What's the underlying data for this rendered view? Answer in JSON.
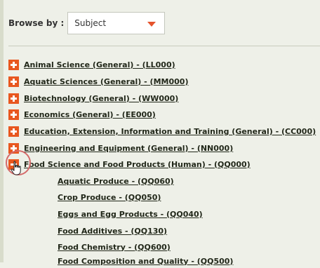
{
  "browse": {
    "label": "Browse by :",
    "selected": "Subject"
  },
  "categories": [
    {
      "label": "Animal Science (General) - (LL000)",
      "state": "collapsed"
    },
    {
      "label": "Aquatic Sciences (General) - (MM000)",
      "state": "collapsed"
    },
    {
      "label": "Biotechnology (General) - (WW000)",
      "state": "collapsed"
    },
    {
      "label": "Economics (General) - (EE000)",
      "state": "collapsed"
    },
    {
      "label": "Education, Extension, Information and Training (General) - (CC000)",
      "state": "collapsed"
    },
    {
      "label": "Engineering and Equipment (General) - (NN000)",
      "state": "collapsed"
    },
    {
      "label": "Food Science and Food Products (Human) - (QQ000)",
      "state": "expanded"
    }
  ],
  "subcategories": [
    {
      "label": "Aquatic Produce - (QQ060)"
    },
    {
      "label": "Crop Produce - (QQ050)"
    },
    {
      "label": "Eggs and Egg Products - (QQ040)"
    },
    {
      "label": "Food Additives - (QQ130)"
    },
    {
      "label": "Food Chemistry - (QQ600)"
    },
    {
      "label": "Food Composition and Quality - (QQ500)"
    }
  ],
  "colors": {
    "accent": "#e8571f",
    "highlight_circle": "#d46a6a",
    "background": "#eef0e8"
  },
  "icons": {
    "expand": "plus-icon",
    "collapse": "minus-icon",
    "pointer": "hand-cursor-icon"
  }
}
